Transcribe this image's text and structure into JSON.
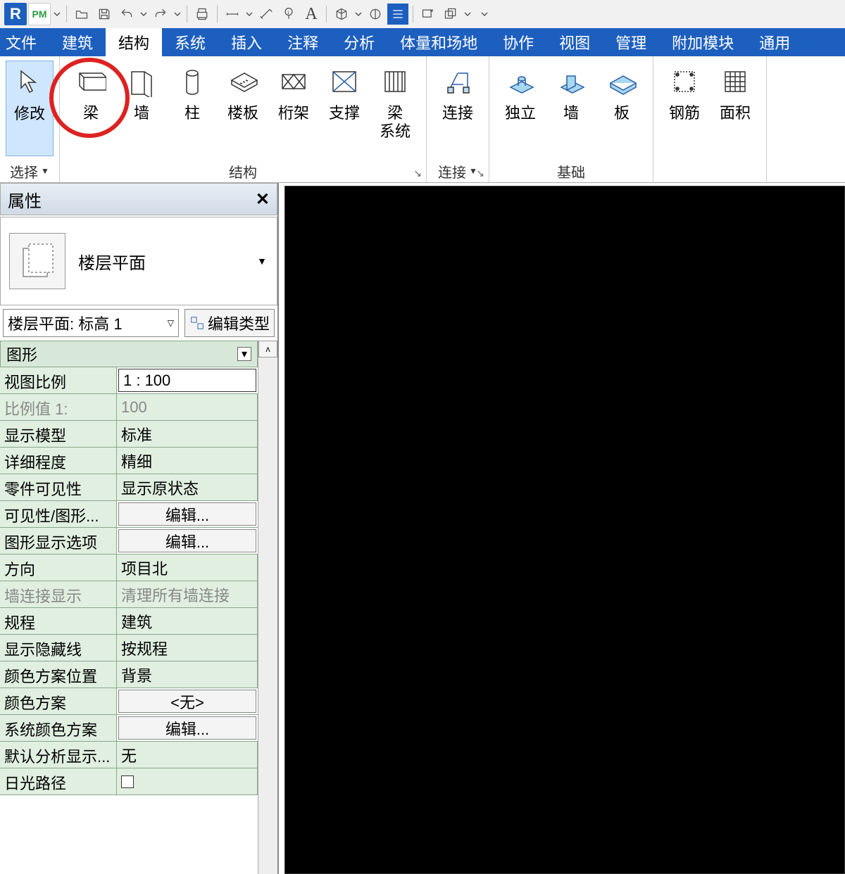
{
  "qat": {
    "app": "R",
    "pm": "PM"
  },
  "tabs": {
    "file": "文件",
    "items": [
      "建筑",
      "结构",
      "系统",
      "插入",
      "注释",
      "分析",
      "体量和场地",
      "协作",
      "视图",
      "管理",
      "附加模块",
      "通用"
    ],
    "activeIndex": 1
  },
  "ribbon": {
    "panels": [
      {
        "title": "选择",
        "caret": true,
        "buttons": [
          {
            "label": "修改",
            "variant": "modify"
          }
        ]
      },
      {
        "title": "结构",
        "launcher": true,
        "buttons": [
          {
            "label": "梁",
            "icon": "beam"
          },
          {
            "label": "墙",
            "icon": "wall"
          },
          {
            "label": "柱",
            "icon": "column"
          },
          {
            "label": "楼板",
            "icon": "floor"
          },
          {
            "label": "桁架",
            "icon": "truss"
          },
          {
            "label": "支撑",
            "icon": "brace"
          },
          {
            "label": "梁\n系统",
            "icon": "beamsys"
          }
        ]
      },
      {
        "title": "连接",
        "caret": true,
        "launcher": true,
        "buttons": [
          {
            "label": "连接",
            "icon": "connect"
          }
        ]
      },
      {
        "title": "基础",
        "buttons": [
          {
            "label": "独立",
            "icon": "isolated"
          },
          {
            "label": "墙",
            "icon": "wallf"
          },
          {
            "label": "板",
            "icon": "slab"
          }
        ]
      },
      {
        "title": "",
        "buttons": [
          {
            "label": "钢筋",
            "icon": "rebar"
          },
          {
            "label": "面积",
            "icon": "area"
          }
        ]
      }
    ]
  },
  "properties": {
    "title": "属性",
    "typeName": "楼层平面",
    "instance": "楼层平面: 标高 1",
    "editType": "编辑类型",
    "categoryLabel": "图形",
    "rows": [
      {
        "k": "视图比例",
        "v": "1 : 100",
        "style": "boxed"
      },
      {
        "k": "比例值 1:",
        "v": "100",
        "disabled": true
      },
      {
        "k": "显示模型",
        "v": "标准"
      },
      {
        "k": "详细程度",
        "v": "精细"
      },
      {
        "k": "零件可见性",
        "v": "显示原状态"
      },
      {
        "k": "可见性/图形...",
        "v": "编辑...",
        "style": "btn"
      },
      {
        "k": "图形显示选项",
        "v": "编辑...",
        "style": "btn"
      },
      {
        "k": "方向",
        "v": "项目北"
      },
      {
        "k": "墙连接显示",
        "v": "清理所有墙连接",
        "disabled": true
      },
      {
        "k": "规程",
        "v": "建筑"
      },
      {
        "k": "显示隐藏线",
        "v": "按规程"
      },
      {
        "k": "颜色方案位置",
        "v": "背景"
      },
      {
        "k": "颜色方案",
        "v": "<无>",
        "style": "btn"
      },
      {
        "k": "系统颜色方案",
        "v": "编辑...",
        "style": "btn"
      },
      {
        "k": "默认分析显示...",
        "v": "无"
      },
      {
        "k": "日光路径",
        "v": "",
        "style": "chk"
      }
    ]
  }
}
